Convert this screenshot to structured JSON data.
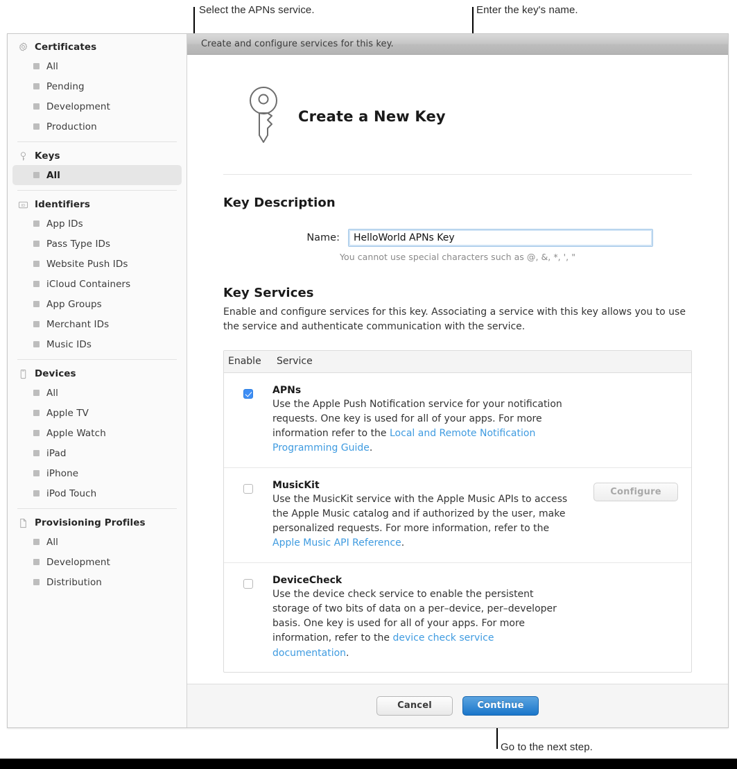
{
  "annotations": [
    {
      "text": "Select the APNs service."
    },
    {
      "text": "Enter the key's name."
    },
    {
      "text": "Go to the next step."
    }
  ],
  "window": {
    "titlebar": "Create and configure services for this key."
  },
  "sidebar": {
    "groups": [
      {
        "icon": "certificate-badge-icon",
        "label": "Certificates",
        "items": [
          {
            "label": "All",
            "selected": false
          },
          {
            "label": "Pending",
            "selected": false
          },
          {
            "label": "Development",
            "selected": false
          },
          {
            "label": "Production",
            "selected": false
          }
        ]
      },
      {
        "icon": "key-icon",
        "label": "Keys",
        "items": [
          {
            "label": "All",
            "selected": true
          }
        ]
      },
      {
        "icon": "identifier-icon",
        "label": "Identifiers",
        "items": [
          {
            "label": "App IDs",
            "selected": false
          },
          {
            "label": "Pass Type IDs",
            "selected": false
          },
          {
            "label": "Website Push IDs",
            "selected": false
          },
          {
            "label": "iCloud Containers",
            "selected": false
          },
          {
            "label": "App Groups",
            "selected": false
          },
          {
            "label": "Merchant IDs",
            "selected": false
          },
          {
            "label": "Music IDs",
            "selected": false
          }
        ]
      },
      {
        "icon": "device-icon",
        "label": "Devices",
        "items": [
          {
            "label": "All",
            "selected": false
          },
          {
            "label": "Apple TV",
            "selected": false
          },
          {
            "label": "Apple Watch",
            "selected": false
          },
          {
            "label": "iPad",
            "selected": false
          },
          {
            "label": "iPhone",
            "selected": false
          },
          {
            "label": "iPod Touch",
            "selected": false
          }
        ]
      },
      {
        "icon": "document-icon",
        "label": "Provisioning Profiles",
        "items": [
          {
            "label": "All",
            "selected": false
          },
          {
            "label": "Development",
            "selected": false
          },
          {
            "label": "Distribution",
            "selected": false
          }
        ]
      }
    ]
  },
  "main": {
    "hero": {
      "icon": "key-outline-icon",
      "title": "Create a New Key"
    },
    "key_description": {
      "title": "Key Description",
      "name_label": "Name:",
      "name_value": "HelloWorld APNs Key",
      "hint": "You cannot use special characters such as @, &, *, ', \""
    },
    "key_services": {
      "title": "Key Services",
      "subtitle": "Enable and configure services for this key. Associating a service with this key allows you to use the service and authenticate communication with the service.",
      "columns": {
        "enable": "Enable",
        "service": "Service"
      },
      "rows": [
        {
          "name": "APNs",
          "checked": true,
          "desc_before": "Use the Apple Push Notification service for your notification requests. One key is used for all of your apps. For more information refer to the ",
          "link": "Local and Remote Notification Programming Guide",
          "desc_after": ".",
          "action": null
        },
        {
          "name": "MusicKit",
          "checked": false,
          "desc_before": "Use the MusicKit service with the Apple Music APIs to access the Apple Music catalog and if authorized by the user, make personalized requests. For more information, refer to the ",
          "link": "Apple Music API Reference",
          "desc_after": ".",
          "action": "Configure"
        },
        {
          "name": "DeviceCheck",
          "checked": false,
          "desc_before": "Use the device check service to enable the persistent storage of two bits of data on a per–device, per–developer basis. One key is used for all of your apps. For more information, refer to the ",
          "link": "device check service documentation",
          "desc_after": ".",
          "action": null
        }
      ]
    },
    "footer": {
      "cancel": "Cancel",
      "continue": "Continue"
    }
  },
  "colors": {
    "link": "#3f9be0",
    "checkbox_on": "#3e8ef5",
    "primary_button": "#1a76ca"
  }
}
